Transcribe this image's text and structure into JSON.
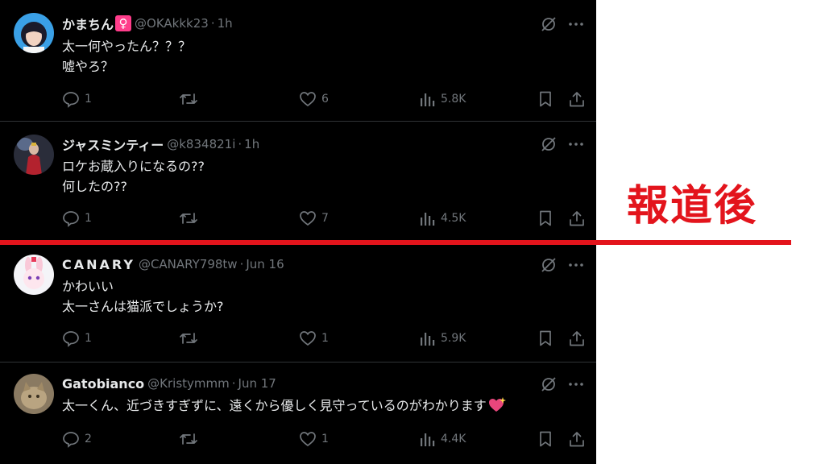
{
  "annotation": {
    "label": "報道後",
    "color": "#e3141c"
  },
  "theme": {
    "background": "#000000",
    "text": "#e7e9ea",
    "muted": "#71767b",
    "badge": "#ff3d8b"
  },
  "tweets": [
    {
      "name": "かまちん",
      "badge": "♀",
      "handle": "@OKAkkk23",
      "time": "1h",
      "lines": [
        "太一何やったん？？？",
        "嘘やろ？"
      ],
      "replies": "1",
      "reposts": "",
      "likes": "6",
      "views": "5.8K",
      "avatar": "woman-portrait"
    },
    {
      "name": "ジャスミンティー",
      "handle": "@k834821i",
      "time": "1h",
      "lines": [
        "ロケお蔵入りになるの??",
        "何したの??"
      ],
      "replies": "1",
      "reposts": "",
      "likes": "7",
      "views": "4.5K",
      "avatar": "performer-photo"
    },
    {
      "name": "CANARY",
      "handle": "@CANARY798tw",
      "time": "Jun 16",
      "lines": [
        "かわいい",
        "太一さんは猫派でしょうか?"
      ],
      "replies": "1",
      "reposts": "",
      "likes": "1",
      "views": "5.9K",
      "avatar": "bunny-character"
    },
    {
      "name": "Gatobianco",
      "handle": "@Kristymmm",
      "time": "Jun 17",
      "lines": [
        "太一くん、近づきすぎずに、遠くから優しく見守っているのがわかります"
      ],
      "emoji": "sparkling-heart",
      "replies": "2",
      "reposts": "",
      "likes": "1",
      "views": "4.4K",
      "avatar": "cat-photo"
    }
  ]
}
